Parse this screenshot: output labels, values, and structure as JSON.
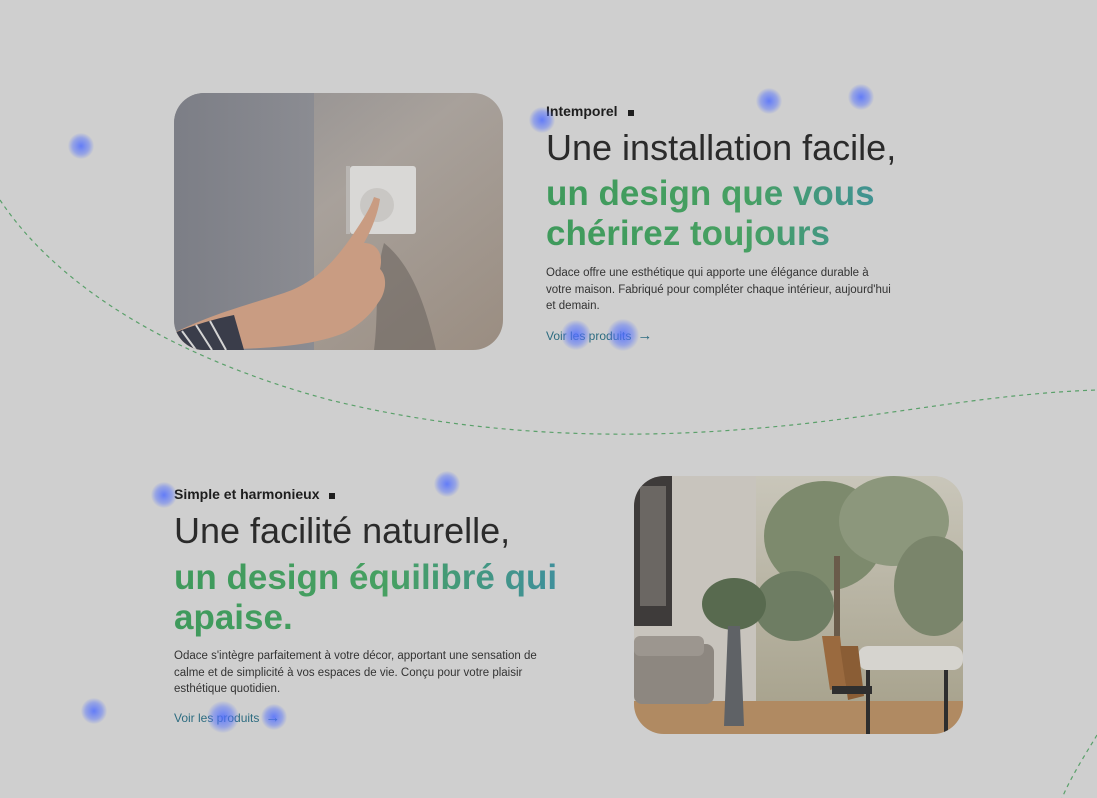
{
  "sections": [
    {
      "eyebrow": "Intemporel",
      "title_line1": "Une installation facile,",
      "title_accent": "un design que vous chérirez toujours",
      "description": "Odace offre une esthétique qui apporte une élégance durable à votre maison. Fabriqué pour compléter chaque intérieur, aujourd'hui et demain.",
      "cta_label": "Voir les produits",
      "cta_arrow": "→"
    },
    {
      "eyebrow": "Simple et harmonieux",
      "title_line1": "Une facilité naturelle,",
      "title_accent": "un design équilibré qui apaise.",
      "description": "Odace s'intègre parfaitement à votre décor, apportant une sensation de calme et de simplicité à vos espaces de vie. Conçu pour votre plaisir esthétique quotidien.",
      "cta_label": "Voir les produits",
      "cta_arrow": "→"
    }
  ],
  "icons": {
    "eyebrow_marker": "square-bullet-icon",
    "cta_arrow": "arrow-right-icon"
  },
  "colors": {
    "background": "#cfcfcf",
    "accent_green": "#47a062",
    "accent_teal": "#3f8f9e",
    "link": "#2d6c80",
    "curve": "#5aa06a",
    "heatmap_dot": "#506eff"
  }
}
